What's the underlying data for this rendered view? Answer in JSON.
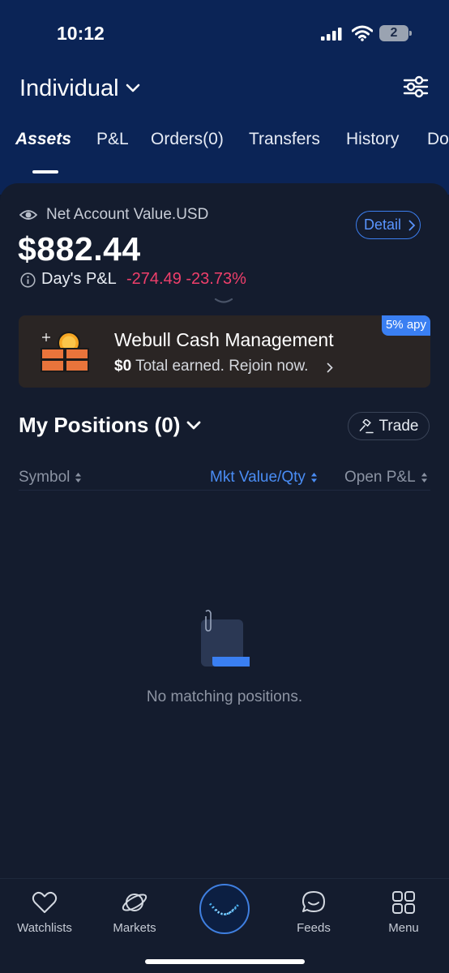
{
  "status_bar": {
    "time": "10:12",
    "battery_level": "2"
  },
  "header": {
    "account_name": "Individual"
  },
  "tabs": [
    {
      "label": "Assets",
      "active": true
    },
    {
      "label": "P&L"
    },
    {
      "label": "Orders(0)"
    },
    {
      "label": "Transfers"
    },
    {
      "label": "History"
    },
    {
      "label": "Do"
    }
  ],
  "account": {
    "net_value_label": "Net Account Value.USD",
    "net_value": "$882.44",
    "detail_label": "Detail",
    "days_pl_label": "Day's P&L",
    "days_pl_value": "-274.49 -23.73%"
  },
  "cash_banner": {
    "title": "Webull Cash Management",
    "earned": "$0",
    "subtitle": "Total earned. Rejoin now.",
    "badge": "5% apy"
  },
  "positions": {
    "title": "My Positions (0)",
    "trade_label": "Trade",
    "columns": [
      "Symbol",
      "Mkt Value/Qty",
      "Open P&L"
    ],
    "empty_text": "No matching positions."
  },
  "bottom_nav": [
    {
      "label": "Watchlists",
      "icon": "heart-icon"
    },
    {
      "label": "Markets",
      "icon": "planet-icon"
    },
    {
      "label": "",
      "icon": "webull-logo-icon"
    },
    {
      "label": "Feeds",
      "icon": "chat-icon"
    },
    {
      "label": "Menu",
      "icon": "grid-icon"
    }
  ],
  "colors": {
    "header_bg": "#0b2456",
    "card_bg": "#141c2e",
    "accent_blue": "#3c7ff0",
    "negative_red": "#ef3f6b",
    "banner_bg": "#2a2524"
  }
}
